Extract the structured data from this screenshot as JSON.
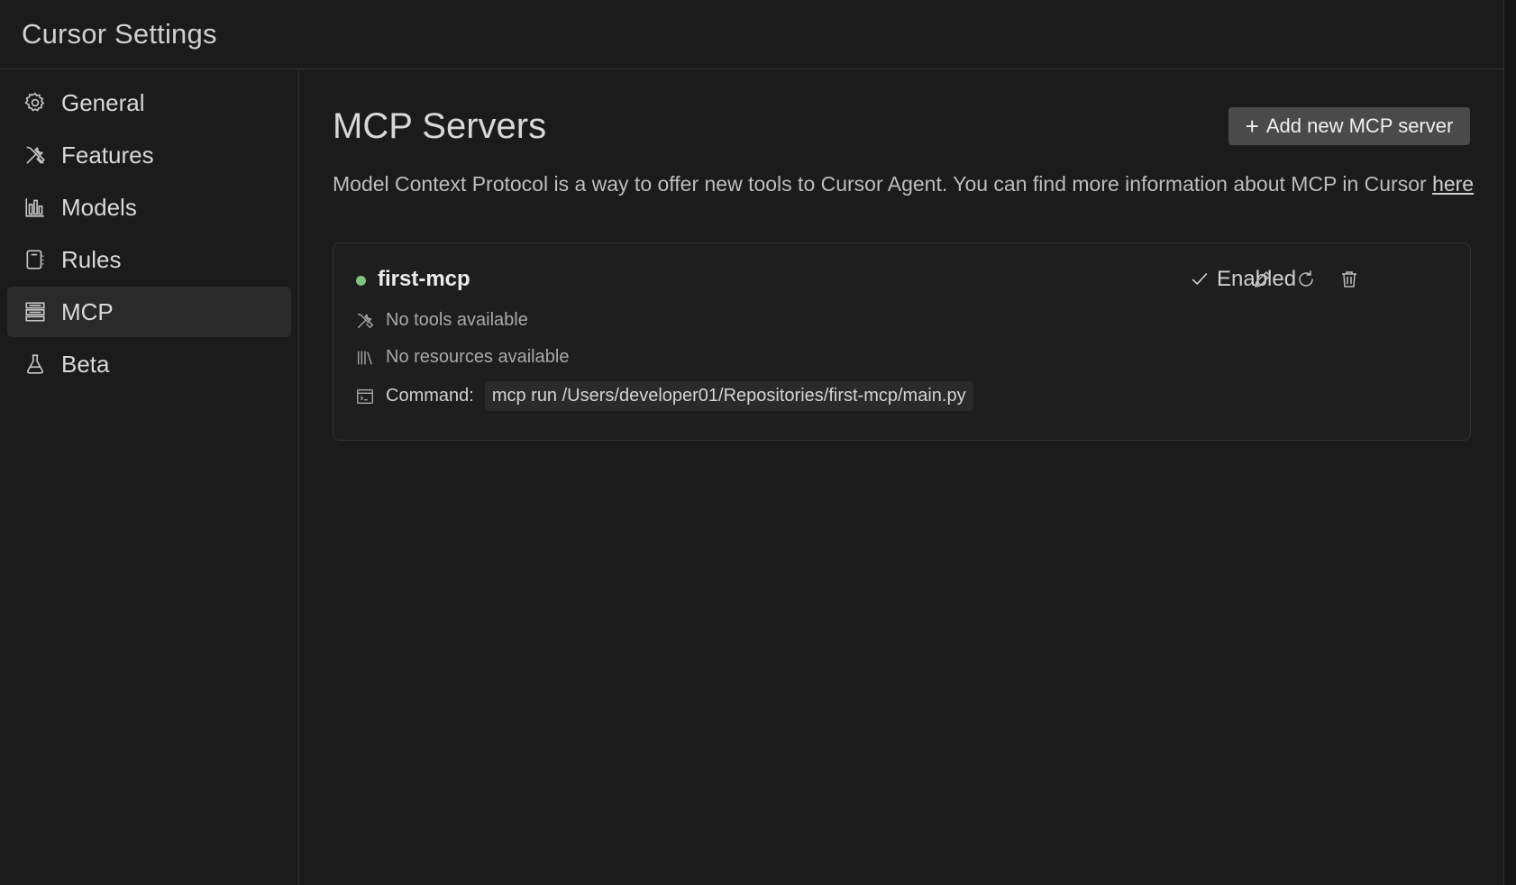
{
  "window": {
    "title": "Cursor Settings"
  },
  "sidebar": {
    "items": [
      {
        "label": "General",
        "icon": "gear-icon",
        "active": false
      },
      {
        "label": "Features",
        "icon": "tools-icon",
        "active": false
      },
      {
        "label": "Models",
        "icon": "bar-chart-icon",
        "active": false
      },
      {
        "label": "Rules",
        "icon": "notebook-icon",
        "active": false
      },
      {
        "label": "MCP",
        "icon": "server-stack-icon",
        "active": true
      },
      {
        "label": "Beta",
        "icon": "flask-icon",
        "active": false
      }
    ]
  },
  "main": {
    "title": "MCP Servers",
    "add_button": {
      "label": "Add new MCP server",
      "icon": "plus-icon"
    },
    "description": {
      "text": "Model Context Protocol is a way to offer new tools to Cursor Agent. You can find more information about MCP in Cursor ",
      "link_label": "here"
    },
    "servers": [
      {
        "name": "first-mcp",
        "status_color": "#7fc37f",
        "enabled_label": "Enabled",
        "tools_text": "No tools available",
        "resources_text": "No resources available",
        "command_label": "Command:",
        "command": "mcp run /Users/developer01/Repositories/first-mcp/main.py",
        "actions": [
          "pencil-icon",
          "refresh-icon",
          "trash-icon"
        ]
      }
    ]
  },
  "colors": {
    "background": "#1b1b1b",
    "active_nav": "#2a2a2a",
    "button": "#4a4a4a",
    "status_green": "#7fc37f"
  }
}
